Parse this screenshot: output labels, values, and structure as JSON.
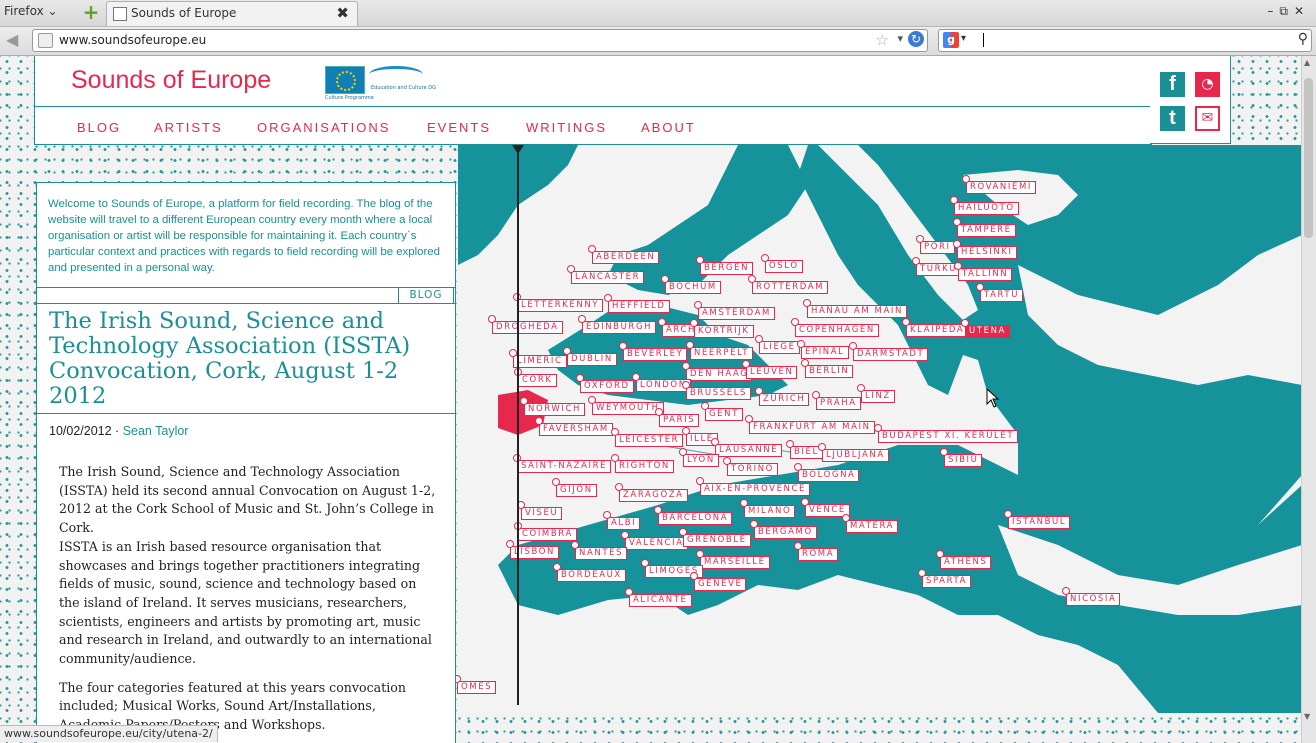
{
  "browser": {
    "app_menu": "Firefox",
    "tab_title": "Sounds of Europe",
    "url": "www.soundsofeurope.eu",
    "status_url": "www.soundsofeurope.eu/city/utena-2/"
  },
  "header": {
    "logo": "Sounds of Europe",
    "eu_caption_top": "Education and Culture DG",
    "eu_caption_bottom": "Culture Programme"
  },
  "nav": {
    "items": [
      "BLOG",
      "ARTISTS",
      "ORGANISATIONS",
      "EVENTS",
      "WRITINGS",
      "ABOUT"
    ]
  },
  "social": {
    "facebook": "f",
    "twitter": "t"
  },
  "colors": {
    "accent": "#e6284d",
    "teal": "#1a8f94"
  },
  "sidebar": {
    "intro": "Welcome to Sounds of Europe, a platform for field recording. The blog of the website will travel to a different European country every month where a local organisation or artist will be responsible for maintaining it. Each country´s particular context and practices with regards to field recording will be explored and presented in a personal way.",
    "tag": "BLOG",
    "post_title": "The Irish Sound, Science and Technology Association (ISSTA) Convocation, Cork, August 1-2 2012",
    "date": "10/02/2012 ·",
    "author": "Sean Taylor",
    "paragraphs": [
      "The Irish Sound, Science and Technology Association (ISSTA) held its second annual Convocation on August 1-2, 2012 at the Cork School of Music and St. John’s College in Cork.",
      "ISSTA is an Irish based resource organisation that showcases and brings together practitioners integrating fields of music, sound, science and technology based on the island of Ireland. It serves musicians, researchers, scientists, engineers and artists by promoting art, music and research in Ireland, and outwardly to an international community/audience.",
      "The four categories featured at this years convocation included; Musical Works, Sound Art/Installations, Academic Papers/Posters and Workshops."
    ]
  },
  "map": {
    "cities": [
      {
        "name": "ROVANIEMI"
      },
      {
        "name": "HAILUOTO"
      },
      {
        "name": "TAMPERE"
      },
      {
        "name": "PORI"
      },
      {
        "name": "HELSINKI"
      },
      {
        "name": "TURKU"
      },
      {
        "name": "TALLINN"
      },
      {
        "name": "TARTU"
      },
      {
        "name": "ABERDEEN"
      },
      {
        "name": "BERGEN"
      },
      {
        "name": "OSLO"
      },
      {
        "name": "LANCASTER"
      },
      {
        "name": "BOCHUM"
      },
      {
        "name": "ROTTERDAM"
      },
      {
        "name": "LETTERKENNY"
      },
      {
        "name": "HEFFIELD"
      },
      {
        "name": "AMSTERDAM"
      },
      {
        "name": "HANAU AM MAIN"
      },
      {
        "name": "DROGHEDA"
      },
      {
        "name": "EDINBURGH"
      },
      {
        "name": "ARCH"
      },
      {
        "name": "KORTRIJK"
      },
      {
        "name": "COPENHAGEN"
      },
      {
        "name": "KLAIPĖDA"
      },
      {
        "name": "UTENA",
        "active": true
      },
      {
        "name": "LIEGE"
      },
      {
        "name": "BEVERLEY"
      },
      {
        "name": "NEERPELT"
      },
      {
        "name": "EPINAL"
      },
      {
        "name": "DARMSTADT"
      },
      {
        "name": "LIMERIC"
      },
      {
        "name": "DUBLIN"
      },
      {
        "name": "DEN HAAG"
      },
      {
        "name": "LEUVEN"
      },
      {
        "name": "BERLIN"
      },
      {
        "name": "CORK"
      },
      {
        "name": "OXFORD"
      },
      {
        "name": "LONDON"
      },
      {
        "name": "BRUSSELS"
      },
      {
        "name": "ZÜRICH"
      },
      {
        "name": "PRAHA"
      },
      {
        "name": "LINZ"
      },
      {
        "name": "NORWICH"
      },
      {
        "name": "WEYMOUTH"
      },
      {
        "name": "GENT"
      },
      {
        "name": "PARIS"
      },
      {
        "name": "FAVERSHAM"
      },
      {
        "name": "FRANKFURT AM MAIN"
      },
      {
        "name": "LEICESTER"
      },
      {
        "name": "ILLE"
      },
      {
        "name": "BUDAPEST XI. KERÜLET"
      },
      {
        "name": "LAUSANNE"
      },
      {
        "name": "BIEL"
      },
      {
        "name": "LJUBLJANA"
      },
      {
        "name": "SAINT-NAZAIRE"
      },
      {
        "name": "RIGHTON"
      },
      {
        "name": "LYON"
      },
      {
        "name": "SIBIU"
      },
      {
        "name": "TORINO"
      },
      {
        "name": "BOLOGNA"
      },
      {
        "name": "GIJÓN"
      },
      {
        "name": "AIX-EN-PROVENCE"
      },
      {
        "name": "ZARAGOZA"
      },
      {
        "name": "VISEU"
      },
      {
        "name": "MILANO"
      },
      {
        "name": "VENCE"
      },
      {
        "name": "BARCELONA"
      },
      {
        "name": "ALBI"
      },
      {
        "name": "ISTANBUL"
      },
      {
        "name": "COIMBRA"
      },
      {
        "name": "BERGAMO"
      },
      {
        "name": "MATERA"
      },
      {
        "name": "VALENCIA"
      },
      {
        "name": "GRENOBLE"
      },
      {
        "name": "LISBON"
      },
      {
        "name": "NANTES"
      },
      {
        "name": "ROMA"
      },
      {
        "name": "MARSEILLE"
      },
      {
        "name": "ATHENS"
      },
      {
        "name": "LIMOGES"
      },
      {
        "name": "BORDEAUX"
      },
      {
        "name": "GENEVE"
      },
      {
        "name": "SPARTA"
      },
      {
        "name": "ALICANTE"
      },
      {
        "name": "NICOSIA"
      },
      {
        "name": "OMES"
      }
    ]
  }
}
